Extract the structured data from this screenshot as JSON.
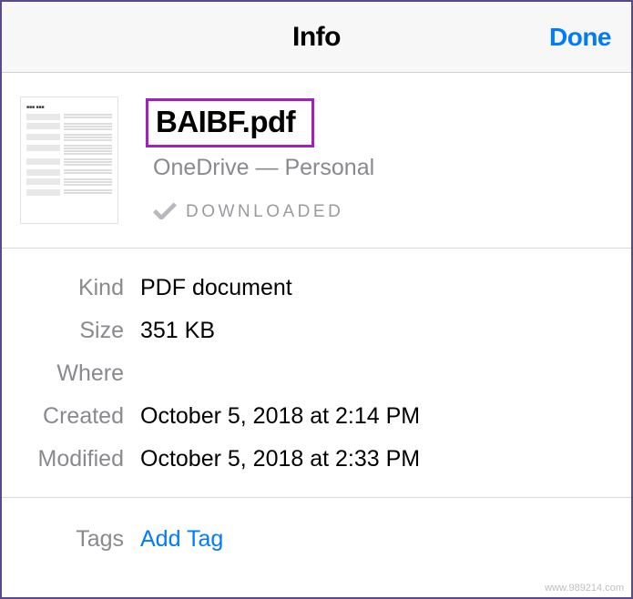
{
  "header": {
    "title": "Info",
    "done_label": "Done"
  },
  "file": {
    "name": "BAIBF.pdf",
    "location": "OneDrive — Personal",
    "status_icon": "checkmark-icon",
    "status_text": "DOWNLOADED"
  },
  "details": {
    "labels": {
      "kind": "Kind",
      "size": "Size",
      "where": "Where",
      "created": "Created",
      "modified": "Modified"
    },
    "values": {
      "kind": "PDF document",
      "size": "351 KB",
      "where": "",
      "created": "October 5, 2018 at 2:14 PM",
      "modified": "October 5, 2018 at 2:33 PM"
    }
  },
  "tags": {
    "label": "Tags",
    "add_tag_label": "Add Tag"
  },
  "watermark": "www.989214.com"
}
